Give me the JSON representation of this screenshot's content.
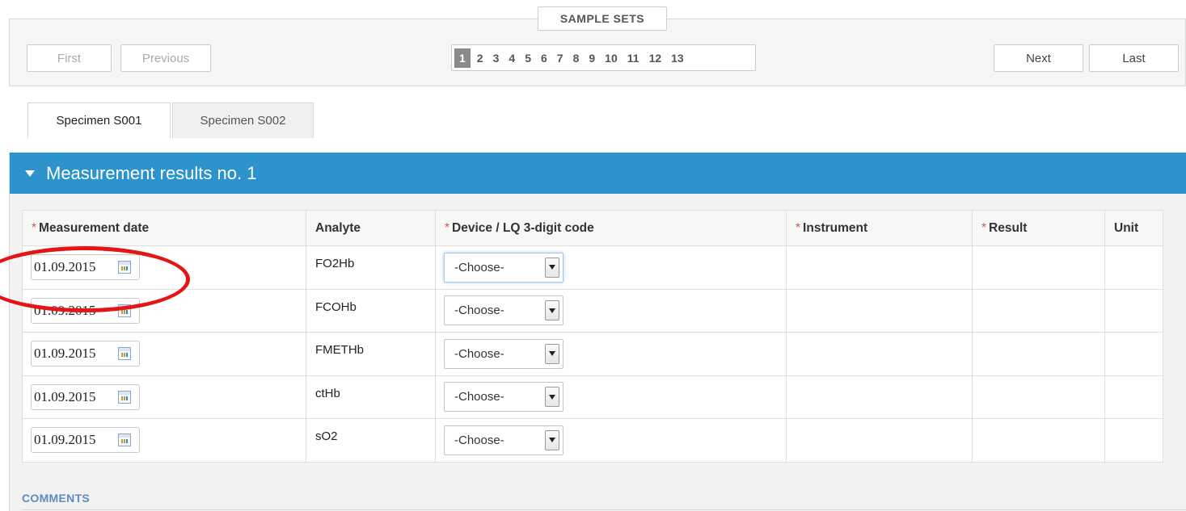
{
  "sample_sets": {
    "legend": "SAMPLE SETS",
    "first_label": "First",
    "previous_label": "Previous",
    "next_label": "Next",
    "last_label": "Last",
    "pages": [
      "1",
      "2",
      "3",
      "4",
      "5",
      "6",
      "7",
      "8",
      "9",
      "10",
      "11",
      "12",
      "13"
    ],
    "current_page": "1"
  },
  "tabs": [
    {
      "label": "Specimen S001",
      "active": true
    },
    {
      "label": "Specimen S002",
      "active": false
    }
  ],
  "section": {
    "title": "Measurement results no. 1"
  },
  "table": {
    "required_marker": "*",
    "columns": [
      {
        "label": "Measurement date",
        "required": true
      },
      {
        "label": "Analyte",
        "required": false
      },
      {
        "label": "Device / LQ 3-digit code",
        "required": true
      },
      {
        "label": "Instrument",
        "required": true
      },
      {
        "label": "Result",
        "required": true
      },
      {
        "label": "Unit",
        "required": false
      }
    ],
    "rows": [
      {
        "date": "01.09.2015",
        "analyte": "FO2Hb",
        "device": "-Choose-",
        "instrument": "",
        "result": "",
        "unit": ""
      },
      {
        "date": "01.09.2015",
        "analyte": "FCOHb",
        "device": "-Choose-",
        "instrument": "",
        "result": "",
        "unit": ""
      },
      {
        "date": "01.09.2015",
        "analyte": "FMETHb",
        "device": "-Choose-",
        "instrument": "",
        "result": "",
        "unit": ""
      },
      {
        "date": "01.09.2015",
        "analyte": "ctHb",
        "device": "-Choose-",
        "instrument": "",
        "result": "",
        "unit": ""
      },
      {
        "date": "01.09.2015",
        "analyte": "sO2",
        "device": "-Choose-",
        "instrument": "",
        "result": "",
        "unit": ""
      }
    ]
  },
  "comments": {
    "heading": "COMMENTS"
  },
  "colors": {
    "section_header": "#2c93cc",
    "required_star": "#d9534f",
    "annotation": "#e31515",
    "comments_heading": "#5b8cc2"
  },
  "icons": {
    "calendar": "calendar-icon",
    "section_toggle": "caret-down-icon",
    "dropdown": "chevron-down-icon"
  }
}
